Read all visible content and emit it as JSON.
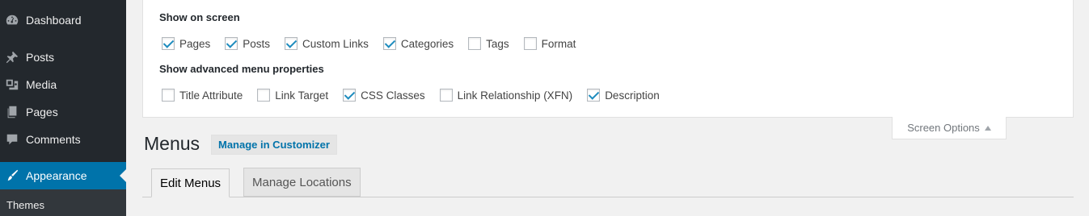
{
  "sidebar": {
    "items": [
      {
        "label": "Dashboard",
        "icon": "dashboard-icon"
      },
      {
        "label": "Posts",
        "icon": "pin-icon"
      },
      {
        "label": "Media",
        "icon": "media-icon"
      },
      {
        "label": "Pages",
        "icon": "pages-icon"
      },
      {
        "label": "Comments",
        "icon": "comment-icon"
      },
      {
        "label": "Appearance",
        "icon": "brush-icon",
        "active": true
      }
    ],
    "submenu": {
      "themes_label": "Themes"
    },
    "colors": {
      "background": "#23282d",
      "active": "#0073aa"
    }
  },
  "screen_options": {
    "show_on_screen_heading": "Show on screen",
    "screen_items": [
      {
        "label": "Pages",
        "checked": true
      },
      {
        "label": "Posts",
        "checked": true
      },
      {
        "label": "Custom Links",
        "checked": true
      },
      {
        "label": "Categories",
        "checked": true
      },
      {
        "label": "Tags",
        "checked": false
      },
      {
        "label": "Format",
        "checked": false
      }
    ],
    "advanced_heading": "Show advanced menu properties",
    "advanced_items": [
      {
        "label": "Title Attribute",
        "checked": false
      },
      {
        "label": "Link Target",
        "checked": false
      },
      {
        "label": "CSS Classes",
        "checked": true
      },
      {
        "label": "Link Relationship (XFN)",
        "checked": false
      },
      {
        "label": "Description",
        "checked": true
      }
    ],
    "toggle_label": "Screen Options"
  },
  "page": {
    "title": "Menus",
    "customizer_link": "Manage in Customizer"
  },
  "tabs": [
    {
      "label": "Edit Menus",
      "active": true
    },
    {
      "label": "Manage Locations",
      "active": false
    }
  ]
}
